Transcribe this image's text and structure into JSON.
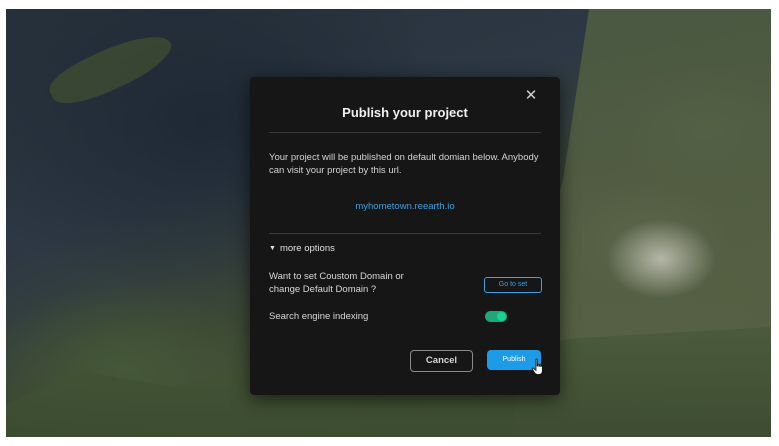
{
  "modal": {
    "title": "Publish your project",
    "close_symbol": "✕",
    "description": "Your project will be published on default domian below. Anybody can visit your project by this url.",
    "url": "myhometown.reearth.io",
    "more_options_label": "more options",
    "custom_domain_text": "Want to set Coustom Domain or change Default Domain ?",
    "goto_set_label": "Go to set",
    "seo_label": "Search engine indexing",
    "seo_enabled": true,
    "cancel_label": "Cancel",
    "publish_label": "Publish"
  },
  "icons": {
    "close": "close-icon",
    "caret": "caret-down-icon",
    "cursor": "hand-pointer-icon"
  },
  "colors": {
    "modal_bg": "#161616",
    "accent": "#1e9be6",
    "link": "#3aa1e6",
    "toggle_on": "#18d28f"
  }
}
